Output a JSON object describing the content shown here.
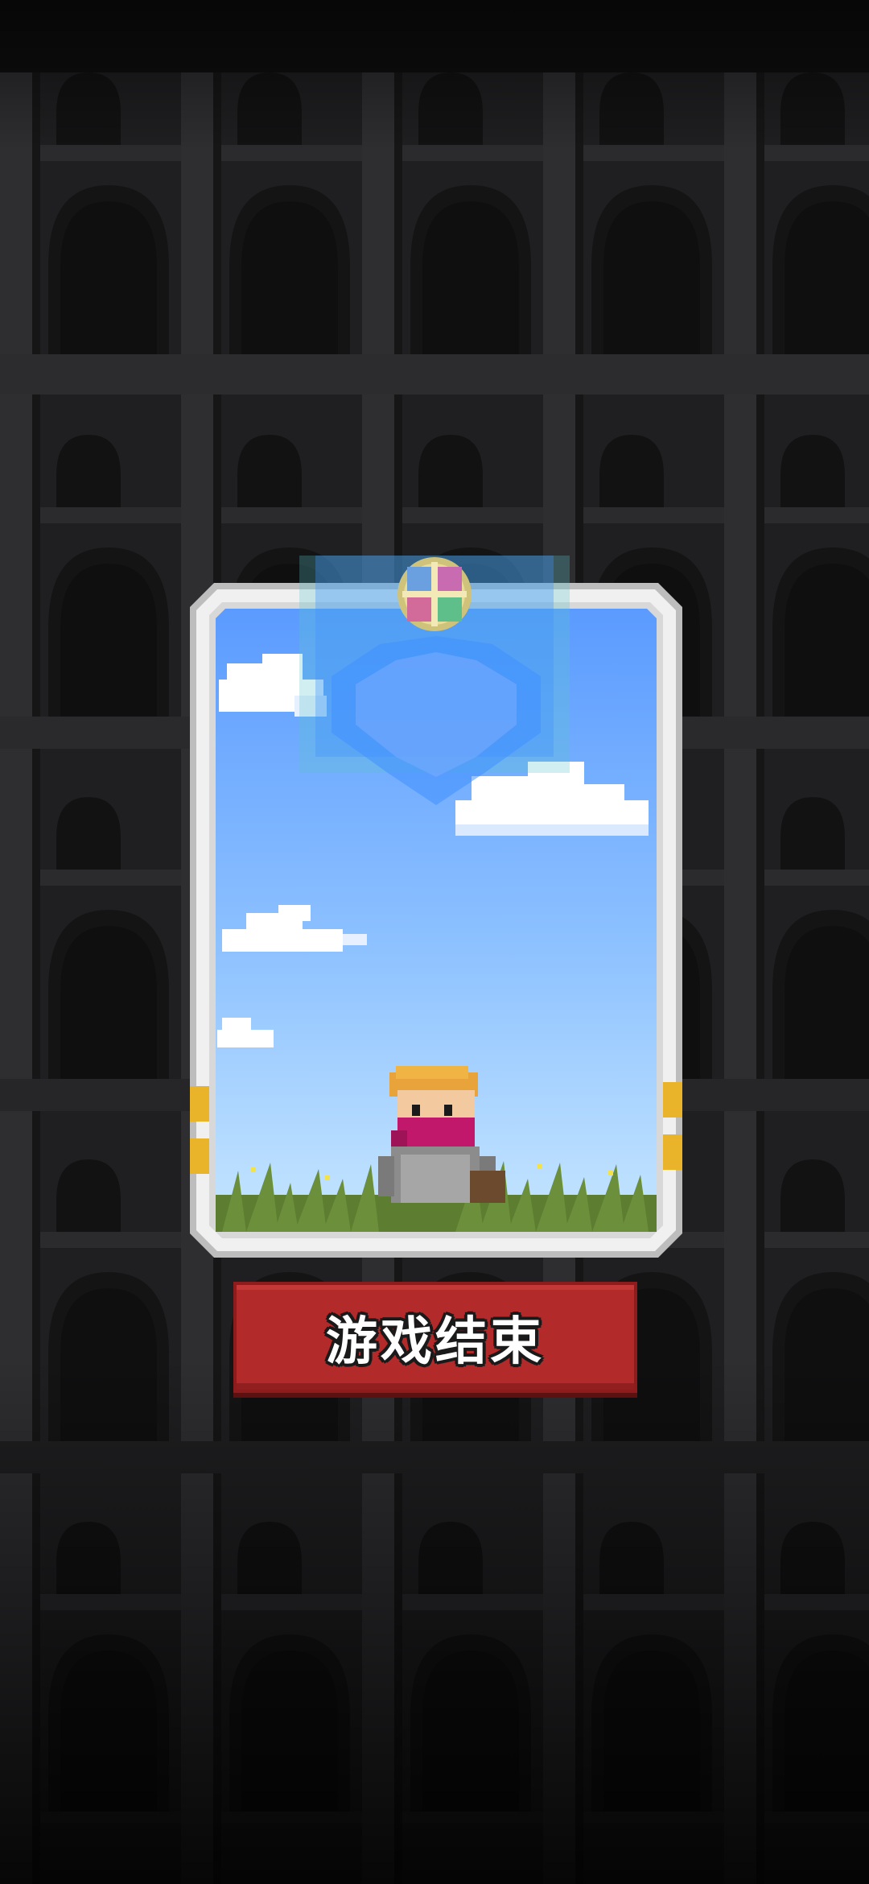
{
  "game": {
    "game_over_label": "游戏结束"
  },
  "icons": {
    "emblem": "compass-emblem-icon",
    "character": "masked-hero-character",
    "coin": "gold-coin-icon"
  },
  "colors": {
    "background": "#0d0d0e",
    "tower_wall": "#2a2a2c",
    "sky_top": "#5b9bff",
    "sky_bottom": "#bde0ff",
    "grass": "#6b8f3a",
    "card_frame": "#e6e6e6",
    "button": "#b22a2a",
    "mask": "#c2186b",
    "hair": "#e8a33a"
  }
}
